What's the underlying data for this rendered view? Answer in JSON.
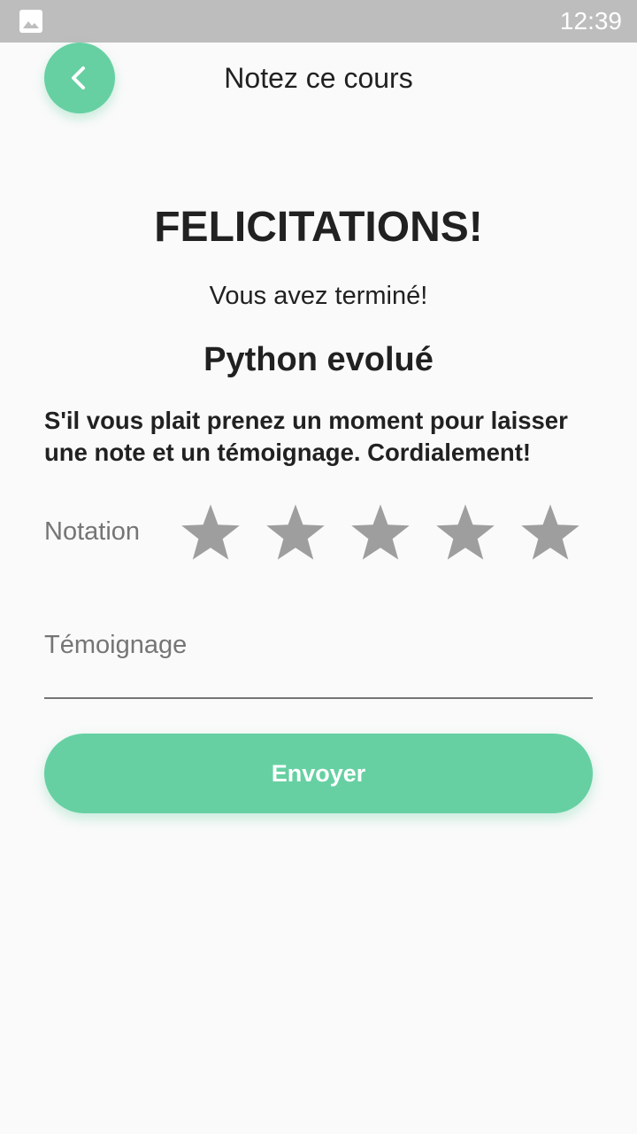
{
  "status_bar": {
    "time": "12:39",
    "notification_icon": "image-icon",
    "background": "#bdbdbd"
  },
  "header": {
    "title": "Notez ce cours",
    "back_icon": "chevron-left-icon"
  },
  "main": {
    "congrats": "FELICITATIONS!",
    "finished_text": "Vous avez terminé!",
    "course_name": "Python evolué",
    "instructions": "S'il vous plait prenez un moment pour laisser une note et un témoignage. Cordialement!"
  },
  "rating": {
    "label": "Notation",
    "max": 5,
    "value": 0,
    "star_icon": "star-icon",
    "empty_color": "#9e9e9e"
  },
  "testimony": {
    "placeholder": "Témoignage",
    "value": ""
  },
  "submit": {
    "label": "Envoyer"
  },
  "colors": {
    "accent": "#66d0a2",
    "background": "#fafafa",
    "text": "#212121",
    "secondary_text": "#757575"
  }
}
